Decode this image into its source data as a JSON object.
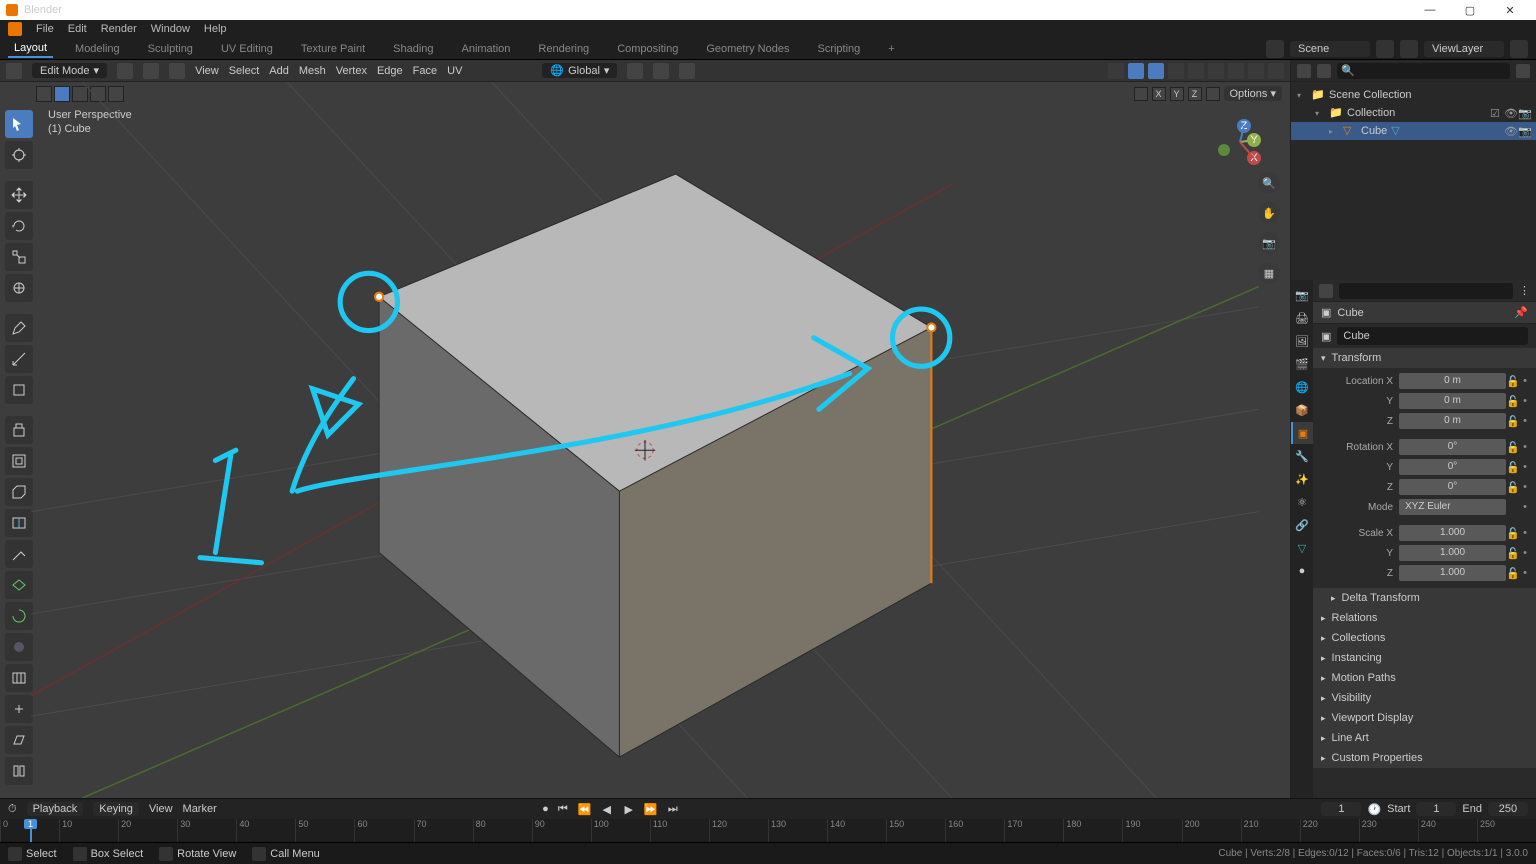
{
  "titlebar": {
    "title": "Blender"
  },
  "menubar": {
    "items": [
      "File",
      "Edit",
      "Render",
      "Window",
      "Help"
    ]
  },
  "workspaces": {
    "tabs": [
      "Layout",
      "Modeling",
      "Sculpting",
      "UV Editing",
      "Texture Paint",
      "Shading",
      "Animation",
      "Rendering",
      "Compositing",
      "Geometry Nodes",
      "Scripting"
    ],
    "active": 0
  },
  "topright": {
    "scene": "Scene",
    "viewlayer": "ViewLayer"
  },
  "vp_header": {
    "mode": "Edit Mode",
    "menus": [
      "View",
      "Select",
      "Add",
      "Mesh",
      "Vertex",
      "Edge",
      "Face",
      "UV"
    ],
    "orientation": "Global"
  },
  "viewinfo": {
    "line1": "User Perspective",
    "line2": "(1) Cube"
  },
  "options_label": "Options",
  "axis_labels": [
    "X",
    "Y",
    "Z"
  ],
  "outliner": {
    "scene_collection": "Scene Collection",
    "collection": "Collection",
    "object": "Cube"
  },
  "props": {
    "bc": "Cube",
    "name": "Cube",
    "panels": {
      "transform": "Transform",
      "delta": "Delta Transform",
      "relations": "Relations",
      "collections": "Collections",
      "instancing": "Instancing",
      "motion": "Motion Paths",
      "visibility": "Visibility",
      "vpdisplay": "Viewport Display",
      "lineart": "Line Art",
      "custom": "Custom Properties"
    },
    "transform": {
      "loc_label": "Location X",
      "loc_x": "0 m",
      "loc_y": "0 m",
      "loc_z": "0 m",
      "rot_label": "Rotation X",
      "rot_x": "0°",
      "rot_y": "0°",
      "rot_z": "0°",
      "mode_label": "Mode",
      "mode_val": "XYZ Euler",
      "scale_label": "Scale X",
      "scale_x": "1.000",
      "scale_y": "1.000",
      "scale_z": "1.000",
      "y_label": "Y",
      "z_label": "Z"
    }
  },
  "timeline": {
    "menus": [
      "Playback",
      "Keying",
      "View",
      "Marker"
    ],
    "current": "1",
    "start_label": "Start",
    "start_val": "1",
    "end_label": "End",
    "end_val": "250",
    "ticks": [
      "0",
      "10",
      "20",
      "30",
      "40",
      "50",
      "60",
      "70",
      "80",
      "90",
      "100",
      "110",
      "120",
      "130",
      "140",
      "150",
      "160",
      "170",
      "180",
      "190",
      "200",
      "210",
      "220",
      "230",
      "240",
      "250"
    ]
  },
  "statusbar": {
    "items": [
      "Select",
      "Box Select",
      "Rotate View",
      "Call Menu"
    ],
    "right": "Cube | Verts:2/8 | Edges:0/12 | Faces:0/6 | Tris:12 | Objects:1/1 | 3.0.0"
  }
}
